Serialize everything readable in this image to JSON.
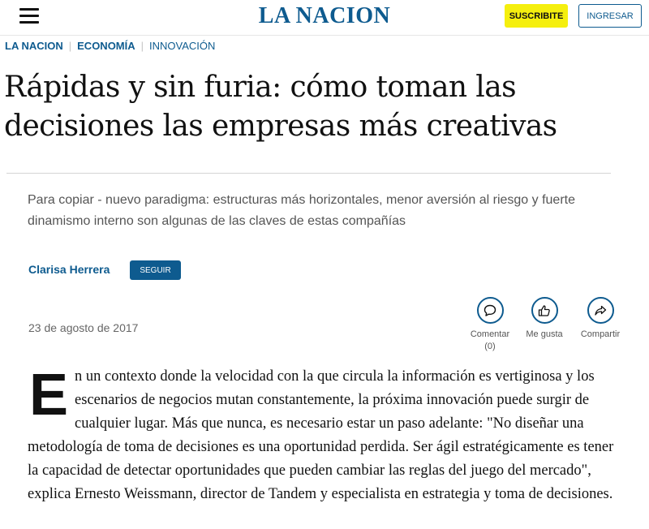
{
  "header": {
    "brand": "LA NACION",
    "subscribe_label": "SUSCRIBITE",
    "login_label": "INGRESAR"
  },
  "breadcrumb": [
    "LA NACION",
    "ECONOMÍA",
    "INNOVACIÓN"
  ],
  "article": {
    "title": "Rápidas y sin furia: cómo toman las decisiones las empresas más creativas",
    "subtitle": "Para copiar - nuevo paradigma: estructuras más horizontales, menor aversión al riesgo y fuerte dinamismo interno son algunas de las claves de estas compañías",
    "author": "Clarisa Herrera",
    "follow_label": "SEGUIR",
    "date": "23 de agosto de 2017",
    "drop_cap": "E",
    "body_rest": "n un contexto donde la velocidad con la que circula la información es vertiginosa y los escenarios de negocios mutan constantemente, la próxima innovación puede surgir de cualquier lugar. Más que nunca, es necesario estar un paso adelante: \"No diseñar una metodología de toma de decisiones es una oportunidad perdida. Ser ágil estratégicamente es tener la capacidad de detectar oportunidades que pueden cambiar las reglas del juego del mercado\", explica Ernesto Weissmann, director de Tandem y especialista en estrategia y toma de decisiones."
  },
  "actions": {
    "comment_label": "Comentar",
    "comment_count": "(0)",
    "like_label": "Me gusta",
    "share_label": "Compartir"
  },
  "colors": {
    "brand_blue": "#0e5b8f",
    "subscribe_yellow": "#f5ef0e"
  },
  "icons": [
    "menu-icon",
    "comment-icon",
    "like-icon",
    "share-icon"
  ]
}
